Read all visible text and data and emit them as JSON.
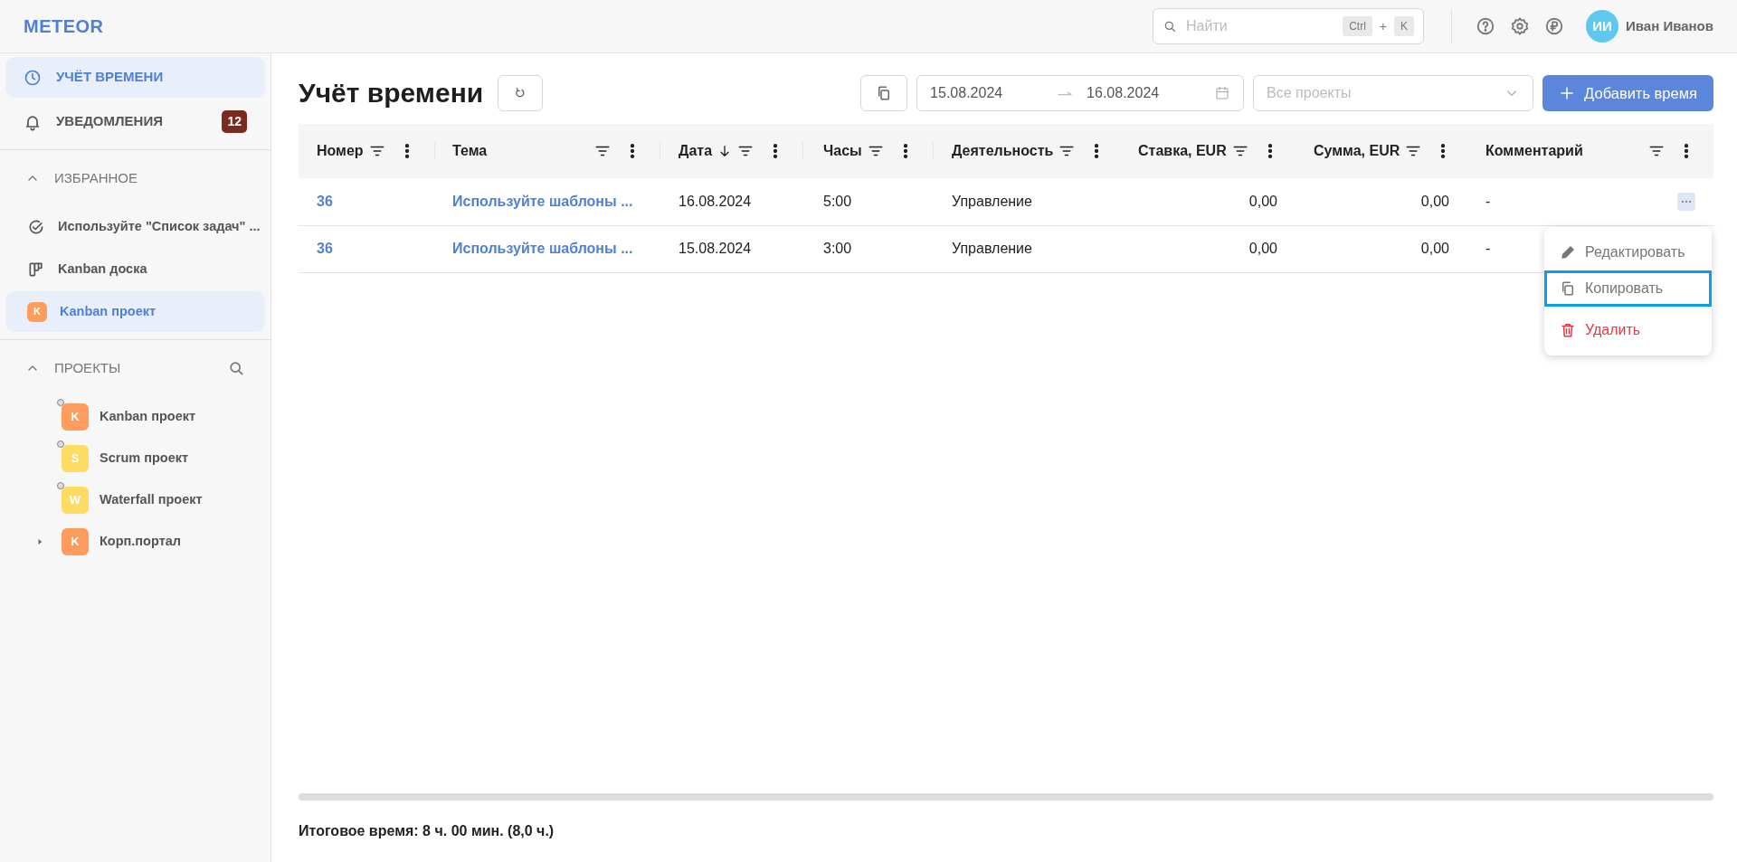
{
  "header": {
    "logo": "METEOR",
    "search": {
      "placeholder": "Найти",
      "keys": [
        "Ctrl",
        "+",
        "K"
      ]
    },
    "user": {
      "initials": "ИИ",
      "name": "Иван Иванов"
    }
  },
  "sidebar": {
    "nav": [
      {
        "label": "УЧЁТ ВРЕМЕНИ",
        "kind": "clock",
        "selected": true
      },
      {
        "label": "УВЕДОМЛЕНИЯ",
        "kind": "bell",
        "selected": false,
        "badge": "12"
      }
    ],
    "favorites": {
      "title": "ИЗБРАННОЕ",
      "expanded": true,
      "items": [
        {
          "label": "Используйте \"Список задач\" ...",
          "kind": "task",
          "selected": false
        },
        {
          "label": "Kanban доска",
          "kind": "board",
          "selected": false
        },
        {
          "label": "Kanban проект",
          "kind": "project",
          "letter": "K",
          "color": "#fd9c5c",
          "selected": true
        }
      ]
    },
    "projects": {
      "title": "ПРОЕКТЫ",
      "expanded": true,
      "items": [
        {
          "label": "Kanban проект",
          "letter": "K",
          "color": "#fd9c5c",
          "dot": true,
          "has_children": false
        },
        {
          "label": "Scrum проект",
          "letter": "S",
          "color": "#fedb62",
          "dot": true,
          "has_children": false
        },
        {
          "label": "Waterfall проект",
          "letter": "W",
          "color": "#fedb62",
          "dot": true,
          "has_children": false
        },
        {
          "label": "Корп.портал",
          "letter": "K",
          "color": "#fd9c5c",
          "dot": false,
          "has_children": true,
          "expanded": false
        }
      ]
    }
  },
  "page": {
    "title": "Учёт времени",
    "date_from": "15.08.2024",
    "date_to": "16.08.2024",
    "project_select": {
      "placeholder": "Все проекты"
    },
    "add_button": "Добавить время"
  },
  "table": {
    "columns": [
      {
        "label": "Номер",
        "sorted_descending": false,
        "kind": "text"
      },
      {
        "label": "Тема",
        "sorted_descending": false,
        "kind": "text"
      },
      {
        "label": "Дата",
        "sorted_descending": true,
        "kind": "text"
      },
      {
        "label": "Часы",
        "sorted_descending": false,
        "kind": "text"
      },
      {
        "label": "Деятельность",
        "sorted_descending": false,
        "kind": "text"
      },
      {
        "label": "Ставка, EUR",
        "sorted_descending": false,
        "kind": "number"
      },
      {
        "label": "Сумма, EUR",
        "sorted_descending": false,
        "kind": "number"
      },
      {
        "label": "Комментарий",
        "sorted_descending": false,
        "kind": "text"
      }
    ],
    "rows": [
      {
        "cells": [
          "36",
          "Используйте шаблоны ...",
          "16.08.2024",
          "5:00",
          "Управление",
          "0,00",
          "0,00",
          "-"
        ],
        "menu_open": true
      },
      {
        "cells": [
          "36",
          "Используйте шаблоны ...",
          "15.08.2024",
          "3:00",
          "Управление",
          "0,00",
          "0,00",
          "-"
        ],
        "menu_open": false
      }
    ]
  },
  "context_menu": {
    "items": [
      {
        "label": "Редактировать",
        "kind": "edit",
        "selected": false
      },
      {
        "label": "Копировать",
        "kind": "copy",
        "selected": true
      },
      {
        "label": "Удалить",
        "kind": "delete",
        "selected": false
      }
    ]
  },
  "footer": {
    "total": "Итоговое время: 8 ч. 00 мин. (8,0 ч.)"
  }
}
